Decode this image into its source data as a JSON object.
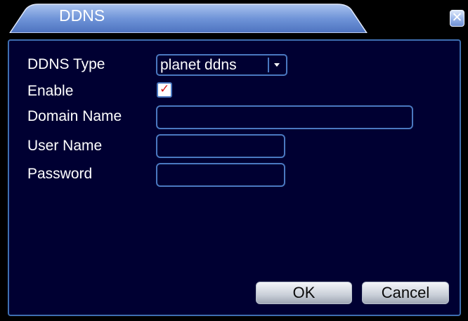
{
  "dialog": {
    "title": "DDNS",
    "close_icon": "close-icon",
    "colors": {
      "panel_bg": "#000032",
      "border": "#4a78c0",
      "title_tab": "#6a8ed2"
    }
  },
  "form": {
    "ddns_type_label": "DDNS Type",
    "ddns_type_value": "planet ddns",
    "enable_label": "Enable",
    "enable_checked": true,
    "domain_label": "Domain Name",
    "domain_value": "",
    "user_label": "User Name",
    "user_value": "",
    "password_label": "Password",
    "password_value": ""
  },
  "buttons": {
    "ok_label": "OK",
    "cancel_label": "Cancel"
  }
}
